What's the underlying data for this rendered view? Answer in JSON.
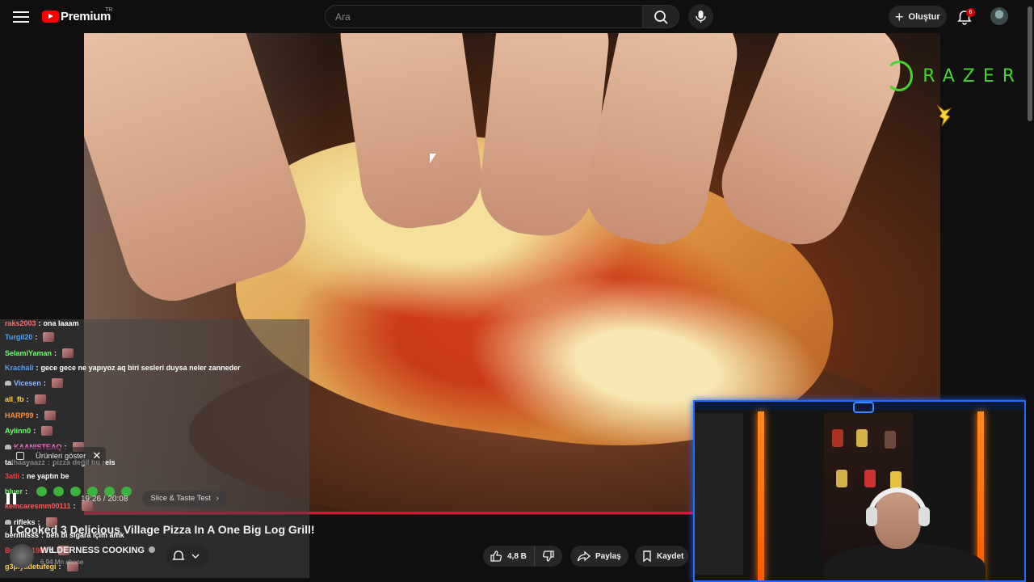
{
  "header": {
    "logo_text": "Premium",
    "country_code": "TR",
    "search_placeholder": "Ara",
    "create_label": "Oluştur",
    "notification_count": "6"
  },
  "player": {
    "current_time": "19:26",
    "duration": "20:08",
    "time_display": "19:26 / 20:08",
    "chapter": "Slice & Taste Test",
    "progress_fraction": 0.966,
    "products_label": "Ürünleri göster",
    "sponsor_overlay_text": "RAZER"
  },
  "chat": {
    "messages": [
      {
        "user": "raks2003",
        "text": "ona laaam",
        "color": "#ff6b6b",
        "emote": false
      },
      {
        "user": "Turgil20",
        "text": "",
        "color": "#4aa3ff",
        "emote": true
      },
      {
        "user": "SelamiYaman",
        "text": "",
        "color": "#6cff6c",
        "emote": true
      },
      {
        "user": "Krachali",
        "text": "gece gece ne yapıyoz aq biri sesleri duysa neler zanneder",
        "color": "#4aa3ff",
        "emote": false
      },
      {
        "user": "Vicesen",
        "text": "",
        "color": "#8fb7ff",
        "emote": true,
        "mod": true
      },
      {
        "user": "all_fb",
        "text": "",
        "color": "#ffd04a",
        "emote": true
      },
      {
        "user": "HARP99",
        "text": "",
        "color": "#ff8f3a",
        "emote": true
      },
      {
        "user": "Aylinn0",
        "text": "",
        "color": "#6cff6c",
        "emote": true
      },
      {
        "user": "KAANISTEAQ",
        "text": "",
        "color": "#ff6bd6",
        "emote": true,
        "mod": true
      },
      {
        "user": "talhaayaazz",
        "text": "pizza değil bu reis",
        "color": "#ffffff",
        "emote": false
      },
      {
        "user": "3atli",
        "text": "ne yaptın be",
        "color": "#ff3a3a",
        "emote": false
      },
      {
        "user": "bluer",
        "text": "",
        "color": "#6cff6c",
        "emote": false,
        "pepes": 6
      },
      {
        "user": "kemcaresmm00111",
        "text": "",
        "color": "#ff5a5a",
        "emote": true
      },
      {
        "user": "rifleks",
        "text": "",
        "color": "#ffffff",
        "emote": true,
        "mod": true
      },
      {
        "user": "berniiisss",
        "text": "ben bi sigara içim amk",
        "color": "#ffffff",
        "emote": false
      },
      {
        "user": "BeyBey1907",
        "text": "",
        "color": "#ff3a3a",
        "emote": true
      },
      {
        "user": "g3piyadetufegi",
        "text": "",
        "color": "#ffd04a",
        "emote": true
      }
    ]
  },
  "video": {
    "title": "I Cooked 3 Delicious Village Pizza In A One Big Log Grill!",
    "channel_name": "WILDERNESS COOKING",
    "subscribers": "6,94 Mn abone",
    "like_count": "4,8 B",
    "share_label": "Paylaş",
    "save_label": "Kaydet"
  },
  "colors": {
    "background": "#0f0f0f",
    "brand_red": "#ff0000",
    "progress_red": "#ff0033",
    "razer_green": "#44d62c",
    "facecam_border": "#1e6fff",
    "neon_orange": "#ff7a00"
  },
  "icons": [
    "menu-icon",
    "youtube-logo-icon",
    "search-icon",
    "mic-icon",
    "plus-icon",
    "bell-icon",
    "like-icon",
    "dislike-icon",
    "share-icon",
    "bookmark-icon",
    "pause-icon",
    "chevron-right-icon",
    "close-icon",
    "razer-logo-icon",
    "pikachu-icon",
    "verified-icon"
  ]
}
